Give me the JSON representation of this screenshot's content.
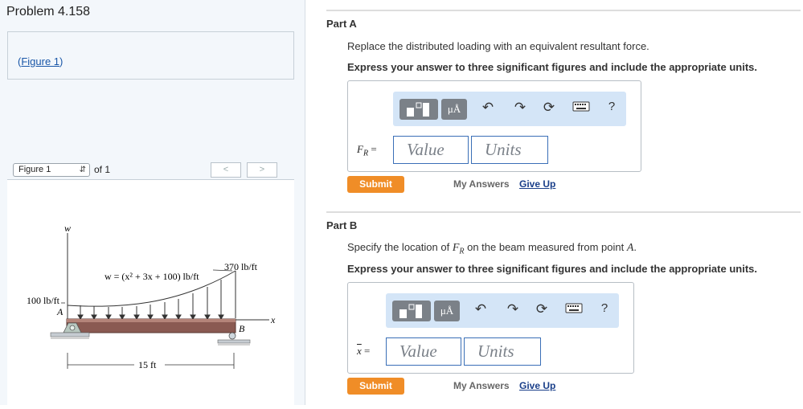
{
  "problem": {
    "title": "Problem 4.158",
    "figure_link": "Figure 1"
  },
  "figure_nav": {
    "selected": "Figure 1",
    "of_text": "of 1",
    "prev": "<",
    "next": ">"
  },
  "figure": {
    "w_axis": "w",
    "equation": "w = (x² + 3x + 100) lb/ft",
    "load_right": "370 lb/ft",
    "load_left": "100 lb/ft",
    "point_a": "A",
    "point_b": "B",
    "x_axis": "x",
    "length": "15 ft"
  },
  "toolbar": {
    "template_label": "",
    "units_label": "μÅ",
    "help": "?"
  },
  "part_a": {
    "title": "Part A",
    "question": "Replace the distributed loading with an equivalent resultant force.",
    "instruction": "Express your answer to three significant figures and include the appropriate units.",
    "var_main": "F",
    "var_sub": "R",
    "var_eq": " =",
    "value_placeholder": "Value",
    "units_placeholder": "Units",
    "submit": "Submit",
    "my_answers": "My Answers",
    "give_up": "Give Up"
  },
  "part_b": {
    "title": "Part B",
    "q_before": "Specify the location of ",
    "q_var": "F",
    "q_sub": "R",
    "q_after": " on the beam measured from point ",
    "q_point": "A",
    "q_end": ".",
    "instruction": "Express your answer to three significant figures and include the appropriate units.",
    "var_main": "x",
    "var_eq": " =",
    "value_placeholder": "Value",
    "units_placeholder": "Units",
    "submit": "Submit",
    "my_answers": "My Answers",
    "give_up": "Give Up"
  }
}
